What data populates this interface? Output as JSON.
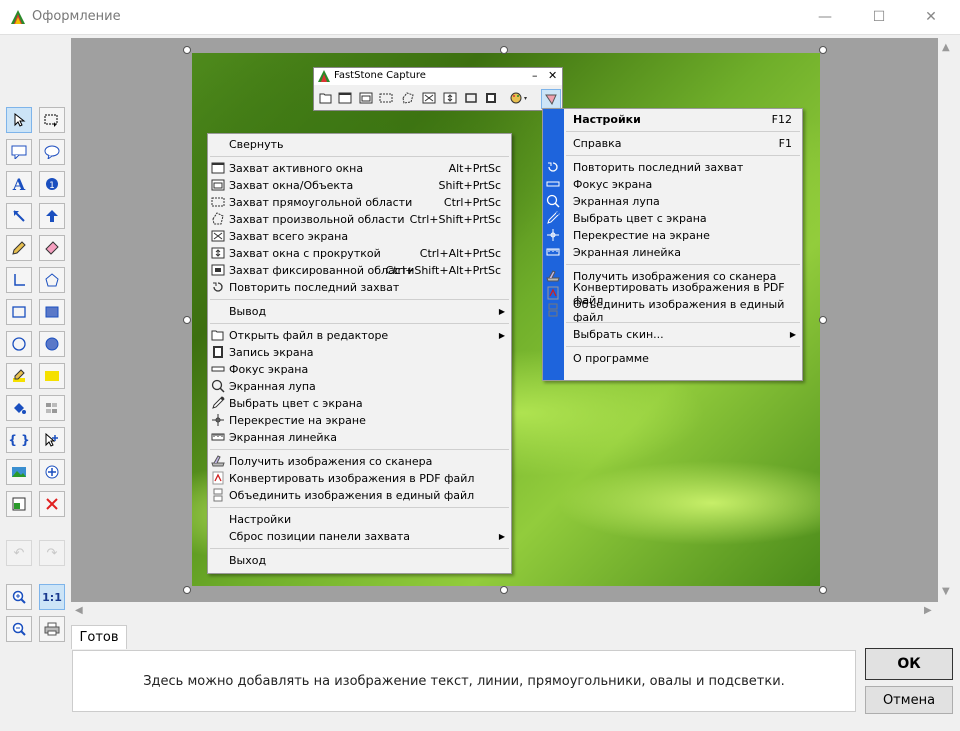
{
  "window": {
    "title": "Оформление",
    "minimize": "—",
    "maximize": "☐",
    "close": "✕"
  },
  "capture_panel": {
    "title": "FastStone Capture",
    "minimize": "–",
    "close": "✕"
  },
  "main_menu": [
    {
      "label": "Свернуть",
      "key": ""
    },
    {
      "sep": true
    },
    {
      "label": "Захват активного окна",
      "key": "Alt+PrtSc",
      "icon": "window-icon"
    },
    {
      "label": "Захват окна/Объекта",
      "key": "Shift+PrtSc",
      "icon": "object-window-icon"
    },
    {
      "label": "Захват прямоугольной области",
      "key": "Ctrl+PrtSc",
      "icon": "rectangle-region-icon"
    },
    {
      "label": "Захват произвольной области",
      "key": "Ctrl+Shift+PrtSc",
      "icon": "freehand-region-icon"
    },
    {
      "label": "Захват всего экрана",
      "key": "",
      "icon": "fullscreen-icon"
    },
    {
      "label": "Захват окна с прокруткой",
      "key": "Ctrl+Alt+PrtSc",
      "icon": "scrolling-window-icon"
    },
    {
      "label": "Захват фиксированной области",
      "key": "Ctrl+Shift+Alt+PrtSc",
      "icon": "fixed-region-icon"
    },
    {
      "label": "Повторить последний захват",
      "key": "",
      "icon": "repeat-icon"
    },
    {
      "sep": true
    },
    {
      "label": "Вывод",
      "key": "",
      "submenu": true
    },
    {
      "sep": true
    },
    {
      "label": "Открыть файл в редакторе",
      "key": "",
      "icon": "open-file-icon",
      "submenu": true
    },
    {
      "label": "Запись экрана",
      "key": "",
      "icon": "film-icon"
    },
    {
      "label": "Фокус экрана",
      "key": "",
      "icon": "focus-icon"
    },
    {
      "label": "Экранная лупа",
      "key": "",
      "icon": "magnifier-icon"
    },
    {
      "label": "Выбрать цвет с экрана",
      "key": "",
      "icon": "eyedropper-icon"
    },
    {
      "label": "Перекрестие на экране",
      "key": "",
      "icon": "crosshair-icon"
    },
    {
      "label": "Экранная линейка",
      "key": "",
      "icon": "ruler-icon"
    },
    {
      "sep": true
    },
    {
      "label": "Получить изображения со сканера",
      "key": "",
      "icon": "scanner-icon"
    },
    {
      "label": "Конвертировать изображения в PDF файл",
      "key": "",
      "icon": "pdf-icon"
    },
    {
      "label": "Объединить изображения в единый файл",
      "key": "",
      "icon": "join-icon"
    },
    {
      "sep": true
    },
    {
      "label": "Настройки",
      "key": ""
    },
    {
      "label": "Сброс позиции панели захвата",
      "key": "",
      "submenu": true
    },
    {
      "sep": true
    },
    {
      "label": "Выход",
      "key": ""
    }
  ],
  "settings_menu": [
    {
      "label": "Настройки",
      "key": "F12",
      "bold": true
    },
    {
      "sep": true
    },
    {
      "label": "Справка",
      "key": "F1"
    },
    {
      "sep": true
    },
    {
      "label": "Повторить последний захват",
      "key": "",
      "icon": "repeat-icon"
    },
    {
      "label": "Фокус экрана",
      "key": "",
      "icon": "focus-icon"
    },
    {
      "label": "Экранная лупа",
      "key": "",
      "icon": "magnifier-icon"
    },
    {
      "label": "Выбрать цвет с экрана",
      "key": "",
      "icon": "eyedropper-icon"
    },
    {
      "label": "Перекрестие на экране",
      "key": "",
      "icon": "crosshair-icon"
    },
    {
      "label": "Экранная линейка",
      "key": "",
      "icon": "ruler-icon"
    },
    {
      "sep": true
    },
    {
      "label": "Получить изображения со сканера",
      "key": "",
      "icon": "scanner-icon"
    },
    {
      "label": "Конвертировать изображения в PDF файл",
      "key": "",
      "icon": "pdf-icon"
    },
    {
      "label": "Объединить изображения в единый файл",
      "key": "",
      "icon": "join-icon"
    },
    {
      "sep": true
    },
    {
      "label": "Выбрать скин...",
      "key": "",
      "submenu": true
    },
    {
      "sep": true
    },
    {
      "label": "О программе",
      "key": ""
    }
  ],
  "toolbar": {
    "zoom_label": "1:1"
  },
  "status": {
    "tab_label": "Готов",
    "hint": "Здесь можно добавлять на изображение текст, линии, прямоугольники, овалы и подсветки."
  },
  "buttons": {
    "ok": "ОК",
    "cancel": "Отмена"
  },
  "colors": {
    "accent_blue": "#1e64dc",
    "selected_tool": "#cce4f7"
  }
}
